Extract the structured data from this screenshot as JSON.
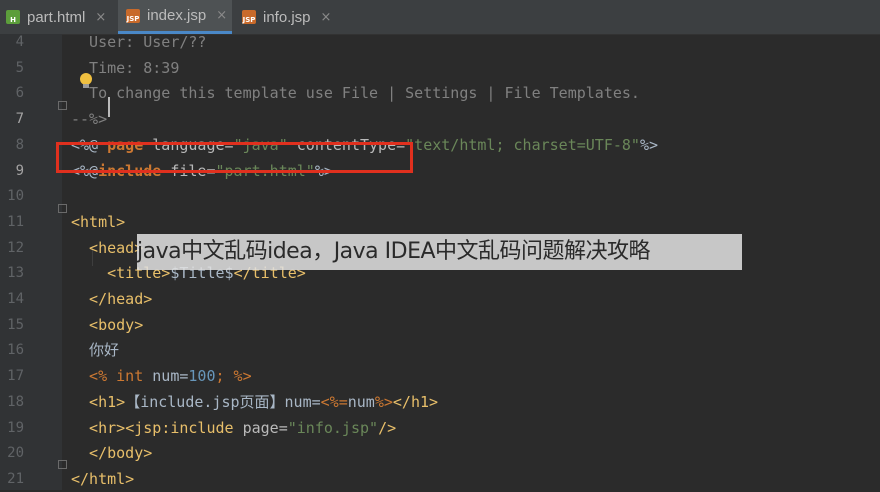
{
  "tabs": [
    {
      "label": "part.html",
      "icon": "html-file-icon",
      "badge": "H"
    },
    {
      "label": "index.jsp",
      "icon": "jsp-file-icon",
      "badge": "JSP",
      "active": true
    },
    {
      "label": "info.jsp",
      "icon": "jsp-file-icon",
      "badge": "JSP"
    }
  ],
  "close_glyph": "×",
  "overlay_caption": "java中文乱码idea，Java IDEA中文乱码问题解决攻略",
  "lines": [
    {
      "n": "4",
      "segs": [
        {
          "c": "cm",
          "t": "  User: User/??"
        }
      ]
    },
    {
      "n": "5",
      "segs": [
        {
          "c": "cm",
          "t": "  Time: 8:39"
        }
      ]
    },
    {
      "n": "6",
      "segs": [
        {
          "c": "cm",
          "t": "  To change this template use File | Settings | File Templates."
        }
      ]
    },
    {
      "n": "7",
      "segs": [
        {
          "c": "cm",
          "t": "--%>"
        }
      ]
    },
    {
      "n": "8",
      "segs": [
        {
          "c": "",
          "t": "<%@ "
        },
        {
          "c": "kw bold",
          "t": "page "
        },
        {
          "c": "attr",
          "t": "language="
        },
        {
          "c": "str",
          "t": "\"java\" "
        },
        {
          "c": "attr",
          "t": "contentType="
        },
        {
          "c": "str",
          "t": "\"text/html; charset=UTF-8\""
        },
        {
          "c": "",
          "t": "%>"
        }
      ]
    },
    {
      "n": "9",
      "segs": [
        {
          "c": "",
          "t": "<%@"
        },
        {
          "c": "kw bold",
          "t": "include "
        },
        {
          "c": "attr",
          "t": "file="
        },
        {
          "c": "str",
          "t": "\"part.html\""
        },
        {
          "c": "",
          "t": "%>"
        }
      ]
    },
    {
      "n": "10",
      "segs": []
    },
    {
      "n": "11",
      "segs": [
        {
          "c": "tag",
          "t": "<html>"
        }
      ]
    },
    {
      "n": "12",
      "segs": [
        {
          "c": "tag",
          "t": "  <head>"
        }
      ]
    },
    {
      "n": "13",
      "segs": [
        {
          "c": "tag",
          "t": "    <title>"
        },
        {
          "c": "",
          "t": "$Title$"
        },
        {
          "c": "tag",
          "t": "</title>"
        }
      ]
    },
    {
      "n": "14",
      "segs": [
        {
          "c": "tag",
          "t": "  </head>"
        }
      ]
    },
    {
      "n": "15",
      "segs": [
        {
          "c": "tag",
          "t": "  <body>"
        }
      ]
    },
    {
      "n": "16",
      "segs": [
        {
          "c": "",
          "t": "  你好"
        }
      ]
    },
    {
      "n": "17",
      "segs": [
        {
          "c": "kw",
          "t": "  <% "
        },
        {
          "c": "kw",
          "t": "int "
        },
        {
          "c": "",
          "t": "num="
        },
        {
          "c": "num",
          "t": "100"
        },
        {
          "c": "kw",
          "t": "; %>"
        }
      ]
    },
    {
      "n": "18",
      "segs": [
        {
          "c": "tag",
          "t": "  <h1>"
        },
        {
          "c": "",
          "t": "【include.jsp页面】num="
        },
        {
          "c": "kw",
          "t": "<%="
        },
        {
          "c": "",
          "t": "num"
        },
        {
          "c": "kw",
          "t": "%>"
        },
        {
          "c": "tag",
          "t": "</h1>"
        }
      ]
    },
    {
      "n": "19",
      "segs": [
        {
          "c": "tag",
          "t": "  <hr>"
        },
        {
          "c": "tag",
          "t": "<jsp"
        },
        {
          "c": "tag",
          "t": ":include "
        },
        {
          "c": "attr",
          "t": "page="
        },
        {
          "c": "str",
          "t": "\"info.jsp\""
        },
        {
          "c": "tag",
          "t": "/>"
        }
      ]
    },
    {
      "n": "20",
      "segs": [
        {
          "c": "tag",
          "t": "  </body>"
        }
      ]
    },
    {
      "n": "21",
      "segs": [
        {
          "c": "tag",
          "t": "</html>"
        }
      ]
    }
  ]
}
